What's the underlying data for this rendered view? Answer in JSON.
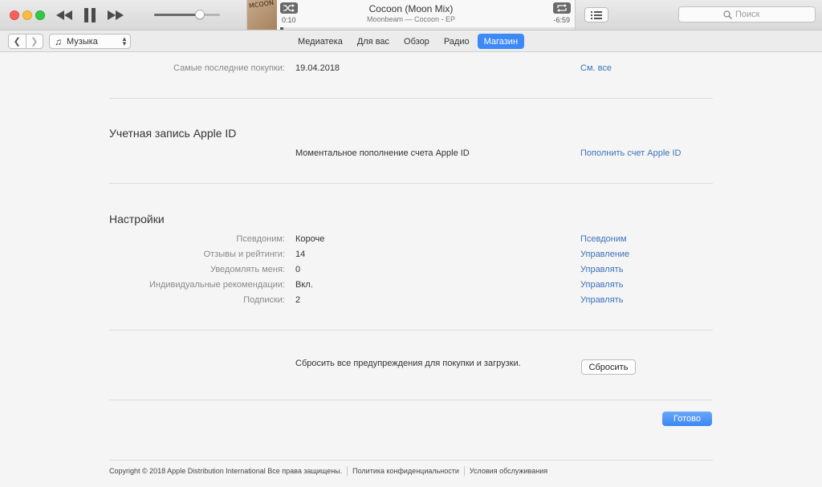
{
  "player": {
    "now_playing_title": "Cocoon (Moon Mix)",
    "now_playing_subtitle": "Moonbeam — Cocoon - EP",
    "elapsed": "0:10",
    "remaining": "-6:59",
    "artwork_text": "MCOON",
    "volume_level": 0.7,
    "progress": 0.01,
    "icons": [
      "rewind-icon",
      "pause-icon",
      "fast-forward-icon",
      "shuffle-icon",
      "repeat-icon",
      "list-icon",
      "search-icon"
    ]
  },
  "search": {
    "placeholder": "Поиск"
  },
  "toolbar": {
    "library_label": "Музыка",
    "tabs": [
      {
        "label": "Медиатека",
        "active": false
      },
      {
        "label": "Для вас",
        "active": false
      },
      {
        "label": "Обзор",
        "active": false
      },
      {
        "label": "Радио",
        "active": false
      },
      {
        "label": "Магазин",
        "active": true
      }
    ]
  },
  "purchases": {
    "label": "Самые последние покупки:",
    "value": "19.04.2018",
    "link": "См. все"
  },
  "apple_id": {
    "heading": "Учетная запись Apple ID",
    "text": "Моментальное пополнение счета Apple ID",
    "link": "Пополнить счет Apple ID"
  },
  "settings": {
    "heading": "Настройки",
    "rows": [
      {
        "label": "Псевдоним:",
        "value": "Короче",
        "link": "Псевдоним"
      },
      {
        "label": "Отзывы и рейтинги:",
        "value": "14",
        "link": "Управление"
      },
      {
        "label": "Уведомлять меня:",
        "value": "0",
        "link": "Управлять"
      },
      {
        "label": "Индивидуальные рекомендации:",
        "value": "Вкл.",
        "link": "Управлять"
      },
      {
        "label": "Подписки:",
        "value": "2",
        "link": "Управлять"
      }
    ]
  },
  "reset": {
    "text": "Сбросить все предупреждения для покупки и загрузки.",
    "button": "Сбросить"
  },
  "done_button": "Готово",
  "footer": {
    "copyright": "Copyright © 2018 Apple Distribution International Все права защищены.",
    "privacy": "Политика конфиденциальности",
    "terms": "Условия обслуживания"
  },
  "colors": {
    "accent": "#3d8af7",
    "link": "#3b73b9"
  }
}
